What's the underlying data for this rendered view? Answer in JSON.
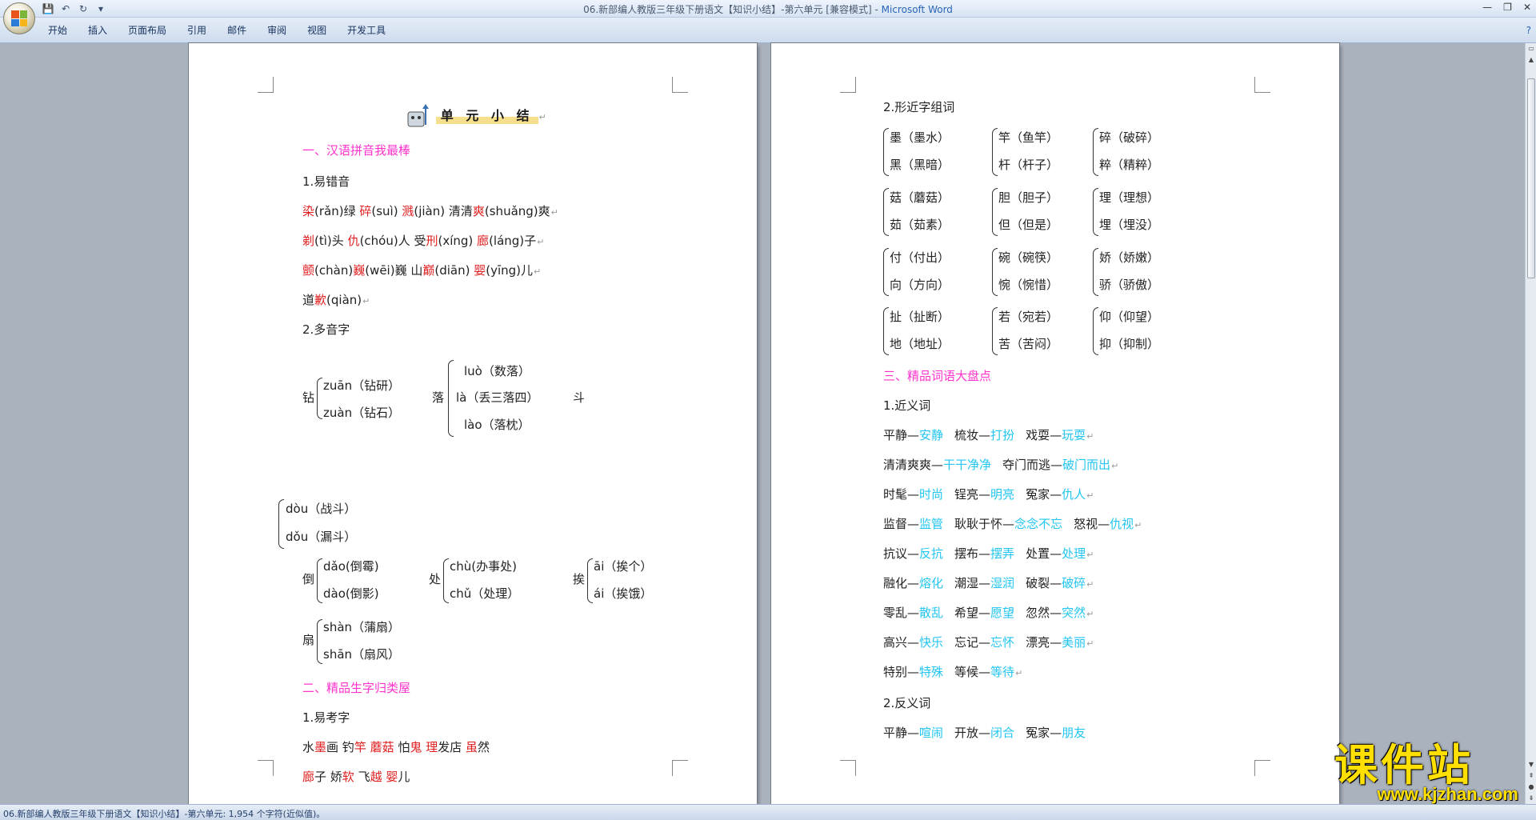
{
  "window": {
    "title": "06.新部编人教版三年级下册语文【知识小结】-第六单元 [兼容模式] - ",
    "app_name": "Microsoft Word",
    "controls": [
      "—",
      "❐",
      "✕"
    ]
  },
  "menu": [
    "开始",
    "插入",
    "页面布局",
    "引用",
    "邮件",
    "审阅",
    "视图",
    "开发工具"
  ],
  "status": "06.新部编人教版三年级下册语文【知识小结】-第六单元: 1,954 个字符(近似值)。",
  "watermark": {
    "cn": "课件站",
    "url": "www.kjzhan.com"
  },
  "left": {
    "title": "单 元 小 结",
    "sec1": "一、汉语拼音我最棒",
    "s1_1": "1.易错音",
    "row1": [
      "染",
      "(rǎn)绿  ",
      "碎",
      "(suì)  ",
      "溅",
      "(jiàn)  清清",
      "爽",
      "(shuǎng)爽"
    ],
    "row2": [
      "剃",
      "(tì)头  ",
      "仇",
      "(chóu)人  受",
      "刑",
      "(xíng)  ",
      "廊",
      "(láng)子"
    ],
    "row3": [
      "颤",
      "(chàn)",
      "巍",
      "(wēi)巍    山",
      "巅",
      "(diān)  ",
      "婴",
      "(yīng)儿"
    ],
    "row4": [
      "道",
      "歉",
      "(qiàn)"
    ],
    "s1_2": "2.多音字",
    "zuan": {
      "char": "钻",
      "a": "zuān（钻研）",
      "b": "zuàn（钻石）"
    },
    "luo": {
      "char": "落",
      "a": "luò（数落）",
      "b": "là（丢三落四）",
      "c": "lào（落枕）"
    },
    "dou": {
      "char": "斗",
      "a": "dòu（战斗）",
      "b": "dǒu（漏斗）"
    },
    "dao": {
      "char": "倒",
      "a": "dǎo(倒霉)",
      "b": "dào(倒影)"
    },
    "chu": {
      "char": "处",
      "a": "chù(办事处)",
      "b": "chǔ（处理）"
    },
    "ai": {
      "char": "挨",
      "a": "āi（挨个）",
      "b": "ái（挨饿）"
    },
    "shan": {
      "char": "扇",
      "a": "shàn（蒲扇）",
      "b": "shān（扇风）"
    },
    "sec2": "二、精品生字归类屋",
    "s2_1": "1.易考字",
    "row5": [
      "水",
      "墨",
      "画  钓",
      "竿",
      "  ",
      "蘑菇",
      "  怕",
      "鬼",
      "  ",
      "理",
      "发店  ",
      "虽",
      "然"
    ],
    "row6": [
      "廊",
      "子  娇",
      "软",
      "  飞",
      "越",
      "  ",
      "婴",
      "儿"
    ]
  },
  "right": {
    "s2_2": "2.形近字组词",
    "groups": [
      [
        [
          "墨（墨水）",
          "黑（黑暗）"
        ],
        [
          "竿（鱼竿）",
          "杆（杆子）"
        ],
        [
          "碎（破碎）",
          "粹（精粹）"
        ]
      ],
      [
        [
          "菇（蘑菇）",
          "茹（茹素）"
        ],
        [
          "胆（胆子）",
          "但（但是）"
        ],
        [
          "理（理想）",
          "埋（埋没）"
        ]
      ],
      [
        [
          "付（付出）",
          "向（方向）"
        ],
        [
          "碗（碗筷）",
          "惋（惋惜）"
        ],
        [
          "娇（娇嫩）",
          "骄（骄傲）"
        ]
      ],
      [
        [
          "扯（扯断）",
          "地（地址）"
        ],
        [
          "若（宛若）",
          "苦（苦闷）"
        ],
        [
          "仰（仰望）",
          "抑（抑制）"
        ]
      ]
    ],
    "sec3": "三、精品词语大盘点",
    "s3_1": "1.近义词",
    "syn": [
      [
        [
          "平静—",
          "安静"
        ],
        [
          "梳妆—",
          "打扮"
        ],
        [
          "戏耍—",
          "玩耍"
        ]
      ],
      [
        [
          "清清爽爽—",
          "干干净净"
        ],
        [
          "夺门而逃—",
          "破门而出"
        ]
      ],
      [
        [
          "时髦—",
          "时尚"
        ],
        [
          "锃亮—",
          "明亮"
        ],
        [
          "冤家—",
          "仇人"
        ]
      ],
      [
        [
          "监督—",
          "监管"
        ],
        [
          "耿耿于怀—",
          "念念不忘"
        ],
        [
          "怒视—",
          "仇视"
        ]
      ],
      [
        [
          "抗议—",
          "反抗"
        ],
        [
          "摆布—",
          "摆弄"
        ],
        [
          "处置—",
          "处理"
        ]
      ],
      [
        [
          "融化—",
          "熔化"
        ],
        [
          "潮湿—",
          "湿润"
        ],
        [
          "破裂—",
          "破碎"
        ]
      ],
      [
        [
          "零乱—",
          "散乱"
        ],
        [
          "希望—",
          "愿望"
        ],
        [
          "忽然—",
          "突然"
        ]
      ],
      [
        [
          "高兴—",
          "快乐"
        ],
        [
          "忘记—",
          "忘怀"
        ],
        [
          "漂亮—",
          "美丽"
        ]
      ],
      [
        [
          "特别—",
          "特殊"
        ],
        [
          "等候—",
          "等待"
        ]
      ]
    ],
    "s3_2": "2.反义词",
    "ant": [
      [
        "平静—",
        "喧闹"
      ],
      [
        "开放—",
        "闭合"
      ],
      [
        "冤家—",
        "朋友"
      ]
    ]
  }
}
